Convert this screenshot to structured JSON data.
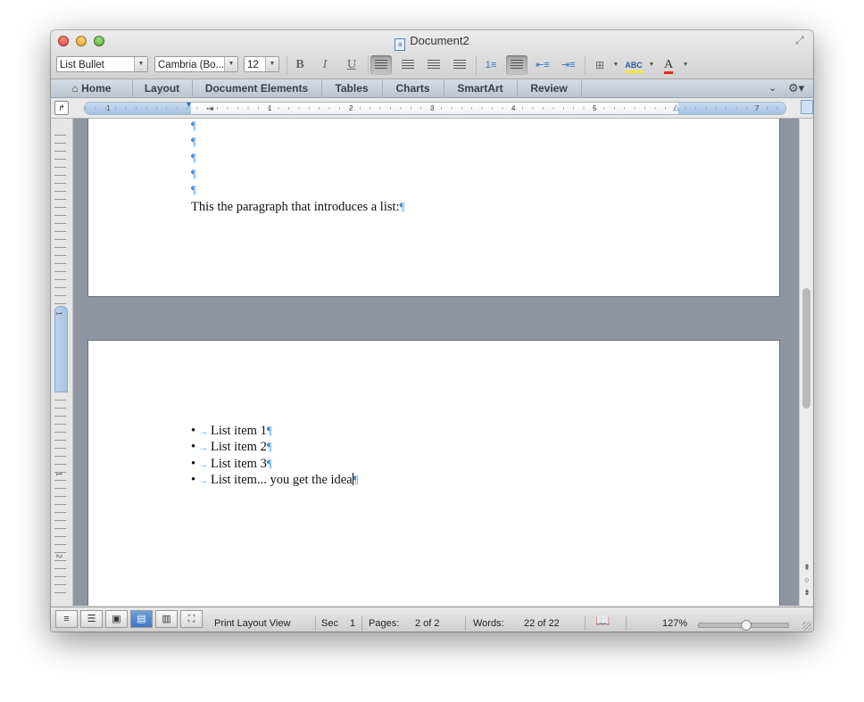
{
  "window": {
    "title": "Document2"
  },
  "toolbar": {
    "style": "List Bullet",
    "font": "Cambria (Bo...",
    "size": "12",
    "bold": "B",
    "italic": "I",
    "underline": "U",
    "align": [
      "align-left",
      "align-center",
      "align-right",
      "justify"
    ],
    "active_align": "align-left",
    "highlight_label": "ABC",
    "font_color_label": "A",
    "highlight_color": "#f5e63b",
    "font_color": "#e0281f"
  },
  "ribbon": {
    "tabs": [
      "Home",
      "Layout",
      "Document Elements",
      "Tables",
      "Charts",
      "SmartArt",
      "Review"
    ]
  },
  "ruler": {
    "numbers": [
      "1",
      "1",
      "2",
      "3",
      "4",
      "5",
      "7"
    ]
  },
  "vruler": {
    "numbers": [
      "1",
      "1",
      "2"
    ]
  },
  "document": {
    "page1": {
      "empty_paragraphs": [
        "¶",
        "¶",
        "¶",
        "¶",
        "¶"
      ],
      "intro": "This the paragraph that introduces a list:",
      "intro_pilcrow": "¶"
    },
    "page2": {
      "list_items": [
        {
          "bullet": "•",
          "text": "List item 1",
          "pilcrow": "¶"
        },
        {
          "bullet": "•",
          "text": "List item 2",
          "pilcrow": "¶"
        },
        {
          "bullet": "•",
          "text": "List item 3",
          "pilcrow": "¶"
        },
        {
          "bullet": "•",
          "text": "List item... you get the idea",
          "pilcrow": "¶"
        }
      ]
    }
  },
  "statusbar": {
    "view": "Print Layout View",
    "sec_label": "Sec",
    "sec_value": "1",
    "pages_label": "Pages:",
    "pages_value": "2 of 2",
    "words_label": "Words:",
    "words_value": "22 of 22",
    "zoom": "127%",
    "zoom_level": 0.5
  }
}
